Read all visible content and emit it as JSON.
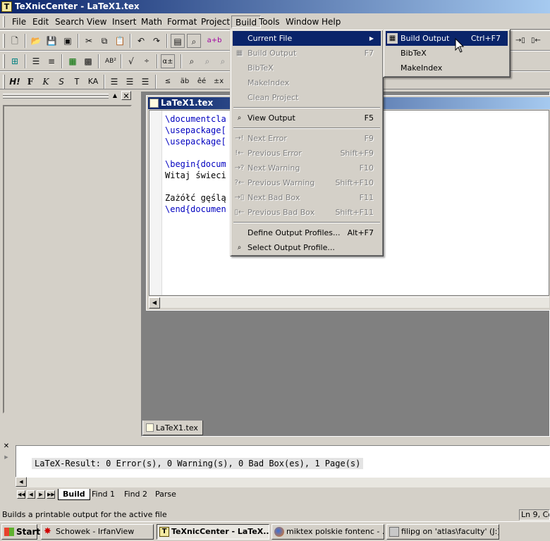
{
  "window": {
    "title": "TeXnicCenter - LaTeX1.tex",
    "app_icon_glyph": "T"
  },
  "menubar": {
    "items": [
      "File",
      "Edit",
      "Search",
      "View",
      "Insert",
      "Math",
      "Format",
      "Project",
      "Build",
      "Tools",
      "Window",
      "Help"
    ],
    "active": "Build"
  },
  "toolbar_row3": {
    "items": [
      "H!",
      "F",
      "K",
      "S",
      "T",
      "KA"
    ]
  },
  "toolbar_row2": {
    "items": [
      "AB²",
      "a+b"
    ]
  },
  "document": {
    "tab_title": "LaTeX1.tex",
    "lines": [
      "\\documentcla",
      "\\usepackage[",
      "\\usepackage[",
      "",
      "\\begin{docum",
      "Witaj świeci",
      "",
      "Zażółć gęślą",
      "\\end{documen"
    ]
  },
  "build_menu": {
    "items": [
      {
        "label": "Current File",
        "shortcut": "",
        "disabled": false,
        "highlighted": true,
        "submenu": true
      },
      {
        "label": "Build Output",
        "shortcut": "F7",
        "disabled": true
      },
      {
        "label": "BibTeX",
        "shortcut": "",
        "disabled": true
      },
      {
        "label": "MakeIndex",
        "shortcut": "",
        "disabled": true
      },
      {
        "label": "Clean Project",
        "shortcut": "",
        "disabled": true
      },
      {
        "label": "View Output",
        "shortcut": "F5",
        "disabled": false
      },
      {
        "label": "Next Error",
        "shortcut": "F9",
        "disabled": true
      },
      {
        "label": "Previous Error",
        "shortcut": "Shift+F9",
        "disabled": true
      },
      {
        "label": "Next Warning",
        "shortcut": "F10",
        "disabled": true
      },
      {
        "label": "Previous Warning",
        "shortcut": "Shift+F10",
        "disabled": true
      },
      {
        "label": "Next Bad Box",
        "shortcut": "F11",
        "disabled": true
      },
      {
        "label": "Previous Bad Box",
        "shortcut": "Shift+F11",
        "disabled": true
      },
      {
        "label": "Define Output Profiles...",
        "shortcut": "Alt+F7",
        "disabled": false
      },
      {
        "label": "Select Output Profile...",
        "shortcut": "",
        "disabled": false
      }
    ]
  },
  "current_file_submenu": {
    "items": [
      {
        "label": "Build Output",
        "shortcut": "Ctrl+F7",
        "highlighted": true
      },
      {
        "label": "BibTeX",
        "shortcut": ""
      },
      {
        "label": "MakeIndex",
        "shortcut": ""
      }
    ]
  },
  "output": {
    "result": "LaTeX-Result: 0 Error(s), 0 Warning(s), 0 Bad Box(es), 1 Page(s)",
    "tabs": [
      "Build",
      "Find 1",
      "Find 2",
      "Parse"
    ],
    "active_tab": "Build"
  },
  "statusbar": {
    "message": "Builds a printable output for the active file",
    "position": "Ln 9, Co"
  },
  "taskbar": {
    "start": "Start",
    "tasks": [
      {
        "label": "Schowek - IrfanView",
        "active": false
      },
      {
        "label": "TeXnicCenter - LaTeX...",
        "active": true
      },
      {
        "label": "miktex polskie fontenc - ...",
        "active": false
      },
      {
        "label": "filipg on 'atlas\\faculty' (J:)",
        "active": false
      }
    ]
  },
  "colors": {
    "titlebar": "#0a246a",
    "face": "#d4d0c8",
    "highlight": "#0a246a",
    "keyword": "#0000c0"
  }
}
